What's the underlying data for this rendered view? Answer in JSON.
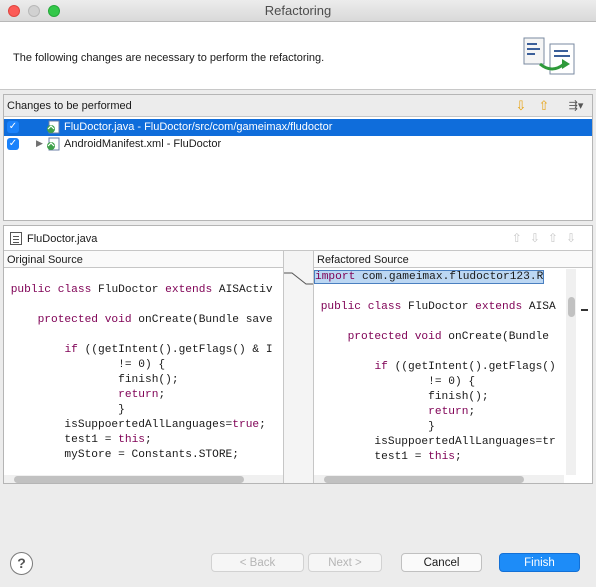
{
  "window": {
    "title": "Refactoring"
  },
  "header": {
    "message": "The following changes are necessary to perform the refactoring."
  },
  "changes": {
    "title": "Changes to be performed",
    "items": [
      {
        "label": "FluDoctor.java - FluDoctor/src/com/gameimax/fludoctor",
        "checked": true,
        "selected": true
      },
      {
        "label": "AndroidManifest.xml - FluDoctor",
        "checked": true,
        "selected": false
      }
    ]
  },
  "compare": {
    "file_label": "FluDoctor.java",
    "left_title": "Original Source",
    "right_title": "Refactored Source"
  },
  "footer": {
    "back_label": "< Back",
    "next_label": "Next >",
    "cancel_label": "Cancel",
    "finish_label": "Finish"
  },
  "colors": {
    "selection": "#0f6ddb",
    "primary_button": "#1d8cf8",
    "keyword": "#7f0055"
  },
  "icons": [
    "help-icon",
    "move-down-icon",
    "move-up-icon",
    "filter-icon",
    "java-file-icon",
    "xml-file-icon",
    "refactoring-wizard-icon"
  ]
}
